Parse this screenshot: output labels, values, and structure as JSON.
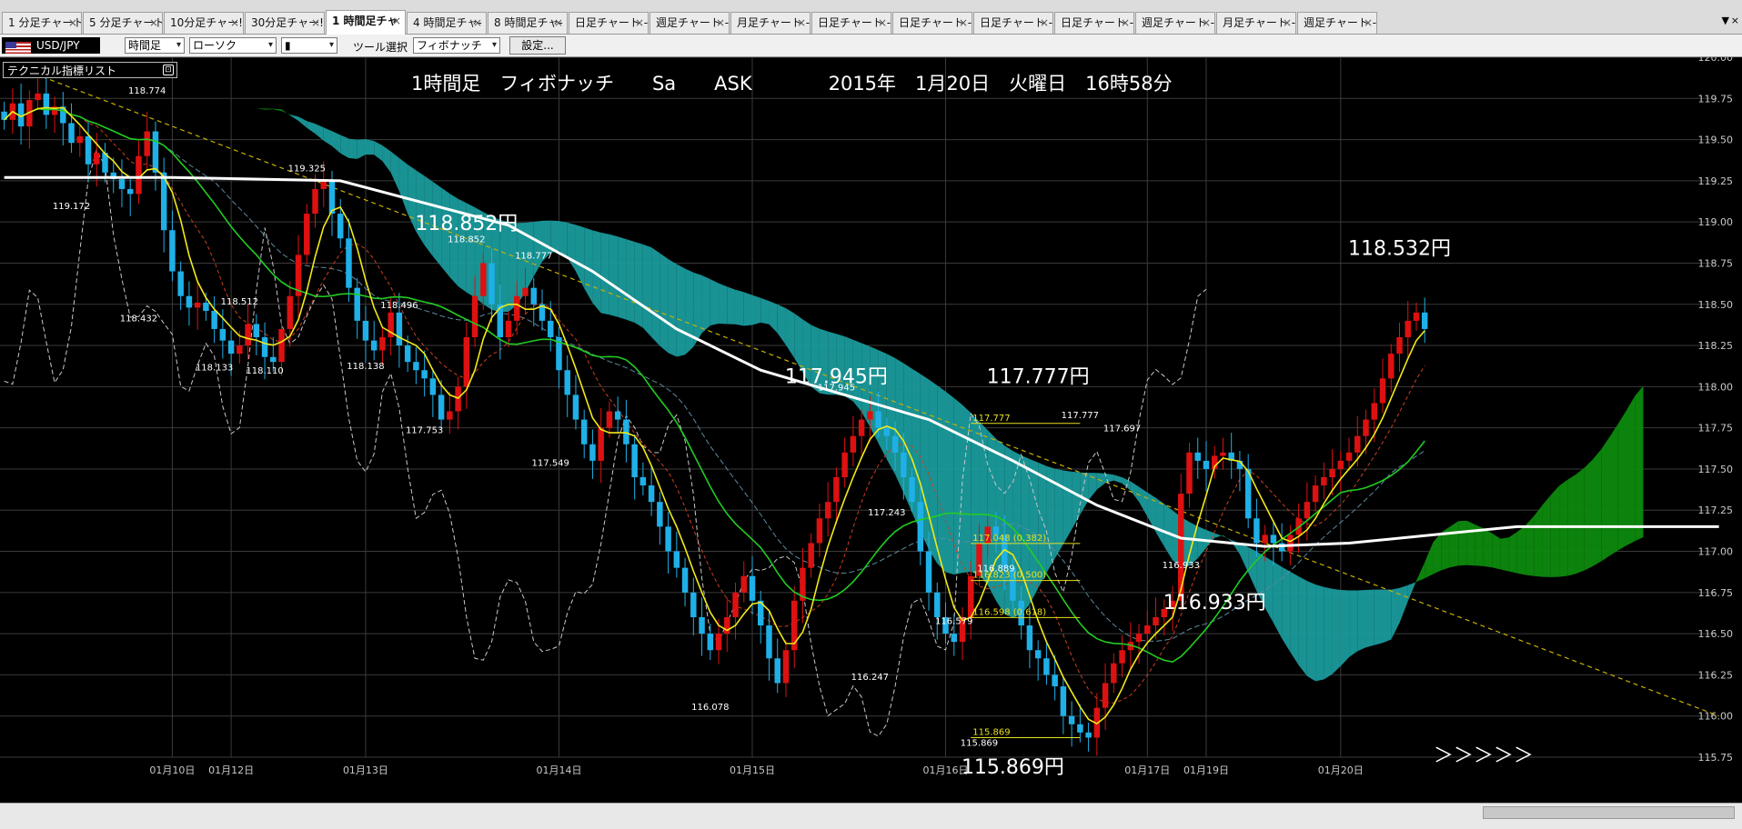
{
  "tabs": [
    {
      "label": "1 分足チャート",
      "active": false
    },
    {
      "label": "5 分足チャート",
      "active": false
    },
    {
      "label": "10分足チャー!",
      "active": false
    },
    {
      "label": "30分足チャー!",
      "active": false
    },
    {
      "label": "1 時間足チャ",
      "active": true
    },
    {
      "label": "4 時間足チャ-",
      "active": false
    },
    {
      "label": "8 時間足チャ-",
      "active": false
    },
    {
      "label": "日足チャート -",
      "active": false
    },
    {
      "label": "週足チャート -",
      "active": false
    },
    {
      "label": "月足チャート -",
      "active": false
    },
    {
      "label": "日足チャート -",
      "active": false
    },
    {
      "label": "日足チャート -",
      "active": false
    },
    {
      "label": "日足チャート -",
      "active": false
    },
    {
      "label": "日足チャート -",
      "active": false
    },
    {
      "label": "週足チャート -",
      "active": false
    },
    {
      "label": "月足チャート -",
      "active": false
    },
    {
      "label": "週足チャート -",
      "active": false
    }
  ],
  "tab_close_glyph": "×",
  "tab_menu_glyph": "▼",
  "tab_bar_close": "×",
  "toolbar": {
    "symbol": "USD/JPY",
    "timeframe": "時間足",
    "chart_kind": "ローソク",
    "candle_glyph": "▮",
    "tool_label": "ツール選択",
    "tool_value": "フィボナッチ",
    "settings_label": "設定...",
    "dropdown_glyph": "▾"
  },
  "tech_list": {
    "label": "テクニカル指標リスト",
    "icon": "⊡"
  },
  "colors": {
    "background": "#000000",
    "grid": "#3a3a3a",
    "up_candle": "#dd1111",
    "down_candle": "#1fb0e8",
    "cloud_bull": "#0d8a0d",
    "cloud_bear": "#1a9a9c",
    "ma_long": "#ffffff",
    "ma_mid": "#22cc22",
    "ma_short": "#f2ea18",
    "ma_slowdash": "#c84020",
    "kijun": "#5a8aa0",
    "chikou": "#c8c8c8",
    "fib": "#e8e020",
    "trendline": "#c8b000",
    "axis_text": "#c8c8c8",
    "annot_text": "#ffffff"
  },
  "chart_data": {
    "type": "candlestick",
    "title": "1時間足　フィボナッチ　　Sa　　ASK　　　　2015年　1月20日　火曜日　16時58分",
    "symbol": "USD/JPY",
    "timeframe": "1時間足",
    "ylim": [
      115.75,
      120.0
    ],
    "y_ticks": [
      {
        "v": 120.0,
        "label": "120.00"
      },
      {
        "v": 119.75,
        "label": "119.75"
      },
      {
        "v": 119.5,
        "label": "119.50"
      },
      {
        "v": 119.25,
        "label": "119.25"
      },
      {
        "v": 119.0,
        "label": "119.00"
      },
      {
        "v": 118.75,
        "label": "118.75"
      },
      {
        "v": 118.5,
        "label": "118.50"
      },
      {
        "v": 118.25,
        "label": "118.25"
      },
      {
        "v": 118.0,
        "label": "118.00"
      },
      {
        "v": 117.75,
        "label": "117.75"
      },
      {
        "v": 117.5,
        "label": "117.50"
      },
      {
        "v": 117.25,
        "label": "117.25"
      },
      {
        "v": 117.0,
        "label": "117.00"
      },
      {
        "v": 116.75,
        "label": "116.75"
      },
      {
        "v": 116.5,
        "label": "116.50"
      },
      {
        "v": 116.25,
        "label": "116.25"
      },
      {
        "v": 116.0,
        "label": "116.00"
      },
      {
        "v": 115.75,
        "label": "115.75"
      }
    ],
    "x_labels": [
      {
        "label": "01月10日",
        "bar": 20
      },
      {
        "label": "01月12日",
        "bar": 27
      },
      {
        "label": "01月13日",
        "bar": 43
      },
      {
        "label": "01月14日",
        "bar": 66
      },
      {
        "label": "01月15日",
        "bar": 89
      },
      {
        "label": "01月16日",
        "bar": 112
      },
      {
        "label": "01月17日",
        "bar": 136
      },
      {
        "label": "01月19日",
        "bar": 143
      },
      {
        "label": "01月20日",
        "bar": 159
      }
    ],
    "bars_visible": 204,
    "close": [
      119.62,
      119.72,
      119.58,
      119.74,
      119.78,
      119.65,
      119.7,
      119.6,
      119.48,
      119.52,
      119.35,
      119.42,
      119.3,
      119.26,
      119.2,
      119.17,
      119.4,
      119.55,
      119.3,
      118.95,
      118.7,
      118.55,
      118.48,
      118.51,
      118.46,
      118.35,
      118.28,
      118.2,
      118.25,
      118.38,
      118.3,
      118.18,
      118.15,
      118.35,
      118.55,
      118.8,
      119.05,
      119.2,
      119.25,
      119.05,
      118.9,
      118.6,
      118.4,
      118.28,
      118.22,
      118.3,
      118.45,
      118.25,
      118.15,
      118.1,
      118.05,
      117.95,
      117.8,
      117.85,
      118.0,
      118.3,
      118.55,
      118.75,
      118.5,
      118.3,
      118.4,
      118.55,
      118.6,
      118.5,
      118.4,
      118.3,
      118.1,
      117.95,
      117.8,
      117.65,
      117.55,
      117.75,
      117.85,
      117.8,
      117.65,
      117.45,
      117.4,
      117.3,
      117.15,
      117.0,
      116.9,
      116.75,
      116.6,
      116.5,
      116.4,
      116.5,
      116.6,
      116.75,
      116.85,
      116.7,
      116.55,
      116.35,
      116.2,
      116.4,
      116.7,
      116.9,
      117.05,
      117.2,
      117.3,
      117.45,
      117.6,
      117.7,
      117.8,
      117.85,
      117.75,
      117.7,
      117.6,
      117.45,
      117.3,
      117.0,
      116.75,
      116.6,
      116.5,
      116.45,
      116.6,
      116.85,
      117.05,
      117.15,
      117.1,
      116.9,
      116.7,
      116.55,
      116.4,
      116.35,
      116.25,
      116.18,
      116.0,
      115.95,
      115.9,
      115.869,
      116.05,
      116.2,
      116.32,
      116.4,
      116.45,
      116.5,
      116.55,
      116.6,
      116.65,
      116.7,
      117.35,
      117.6,
      117.55,
      117.5,
      117.58,
      117.6,
      117.55,
      117.5,
      117.2,
      117.05,
      117.1,
      117.05,
      117.0,
      117.1,
      117.2,
      117.3,
      117.4,
      117.45,
      117.5,
      117.55,
      117.6,
      117.7,
      117.8,
      117.9,
      118.05,
      118.2,
      118.3,
      118.4,
      118.45,
      118.35
    ],
    "ma_long": [
      [
        0,
        119.27
      ],
      [
        20,
        119.27
      ],
      [
        40,
        119.25
      ],
      [
        60,
        118.98
      ],
      [
        70,
        118.7
      ],
      [
        80,
        118.35
      ],
      [
        90,
        118.1
      ],
      [
        100,
        117.95
      ],
      [
        110,
        117.8
      ],
      [
        120,
        117.55
      ],
      [
        130,
        117.28
      ],
      [
        140,
        117.08
      ],
      [
        150,
        117.03
      ],
      [
        160,
        117.05
      ],
      [
        170,
        117.1
      ],
      [
        180,
        117.15
      ],
      [
        204,
        117.15
      ]
    ],
    "annotations": [
      {
        "text": "118.852円",
        "bar": 55,
        "price": 118.95,
        "size": 22
      },
      {
        "text": "117.945円",
        "bar": 99,
        "price": 118.02,
        "size": 22
      },
      {
        "text": "117.777円",
        "bar": 123,
        "price": 118.02,
        "size": 22
      },
      {
        "text": "118.532円",
        "bar": 166,
        "price": 118.8,
        "size": 22
      },
      {
        "text": "116.933円",
        "bar": 144,
        "price": 116.65,
        "size": 22
      },
      {
        "text": "115.869円",
        "bar": 120,
        "price": 115.65,
        "size": 22
      },
      {
        "text": "＞＞＞＞＞",
        "bar": 176,
        "price": 115.72,
        "size": 22
      }
    ],
    "small_labels": [
      {
        "text": "118.774",
        "bar": 17,
        "price": 119.8
      },
      {
        "text": "119.172",
        "bar": 8,
        "price": 119.1
      },
      {
        "text": "119.325",
        "bar": 36,
        "price": 119.33
      },
      {
        "text": "118.852",
        "bar": 55,
        "price": 118.9
      },
      {
        "text": "118.777",
        "bar": 63,
        "price": 118.8
      },
      {
        "text": "118.432",
        "bar": 16,
        "price": 118.42
      },
      {
        "text": "118.512",
        "bar": 28,
        "price": 118.52
      },
      {
        "text": "118.496",
        "bar": 47,
        "price": 118.5
      },
      {
        "text": "118.133",
        "bar": 25,
        "price": 118.12
      },
      {
        "text": "118.110",
        "bar": 31,
        "price": 118.1
      },
      {
        "text": "118.138",
        "bar": 43,
        "price": 118.13
      },
      {
        "text": "117.753",
        "bar": 50,
        "price": 117.74
      },
      {
        "text": "117.549",
        "bar": 65,
        "price": 117.54
      },
      {
        "text": "117.945",
        "bar": 99,
        "price": 118.0
      },
      {
        "text": "117.243",
        "bar": 105,
        "price": 117.24
      },
      {
        "text": "116.078",
        "bar": 84,
        "price": 116.06
      },
      {
        "text": "116.247",
        "bar": 103,
        "price": 116.24
      },
      {
        "text": "116.579",
        "bar": 113,
        "price": 116.58
      },
      {
        "text": "115.869",
        "bar": 116,
        "price": 115.84
      },
      {
        "text": "117.777",
        "bar": 128,
        "price": 117.83
      },
      {
        "text": "117.697",
        "bar": 133,
        "price": 117.75
      },
      {
        "text": "116.933",
        "bar": 140,
        "price": 116.92
      },
      {
        "text": "116.889",
        "bar": 118,
        "price": 116.9
      }
    ],
    "fibonacci": {
      "high": 117.777,
      "low": 115.869,
      "levels": [
        {
          "price": 117.777,
          "label": "117.777"
        },
        {
          "price": 117.048,
          "label": "117.048 (0.382)"
        },
        {
          "price": 116.823,
          "label": "116.823 (0.500)"
        },
        {
          "price": 116.598,
          "label": "116.598 (0.618)"
        },
        {
          "price": 115.869,
          "label": "115.869"
        }
      ]
    },
    "trendline": [
      [
        0,
        119.97
      ],
      [
        204,
        116.0
      ]
    ],
    "grid": true
  }
}
